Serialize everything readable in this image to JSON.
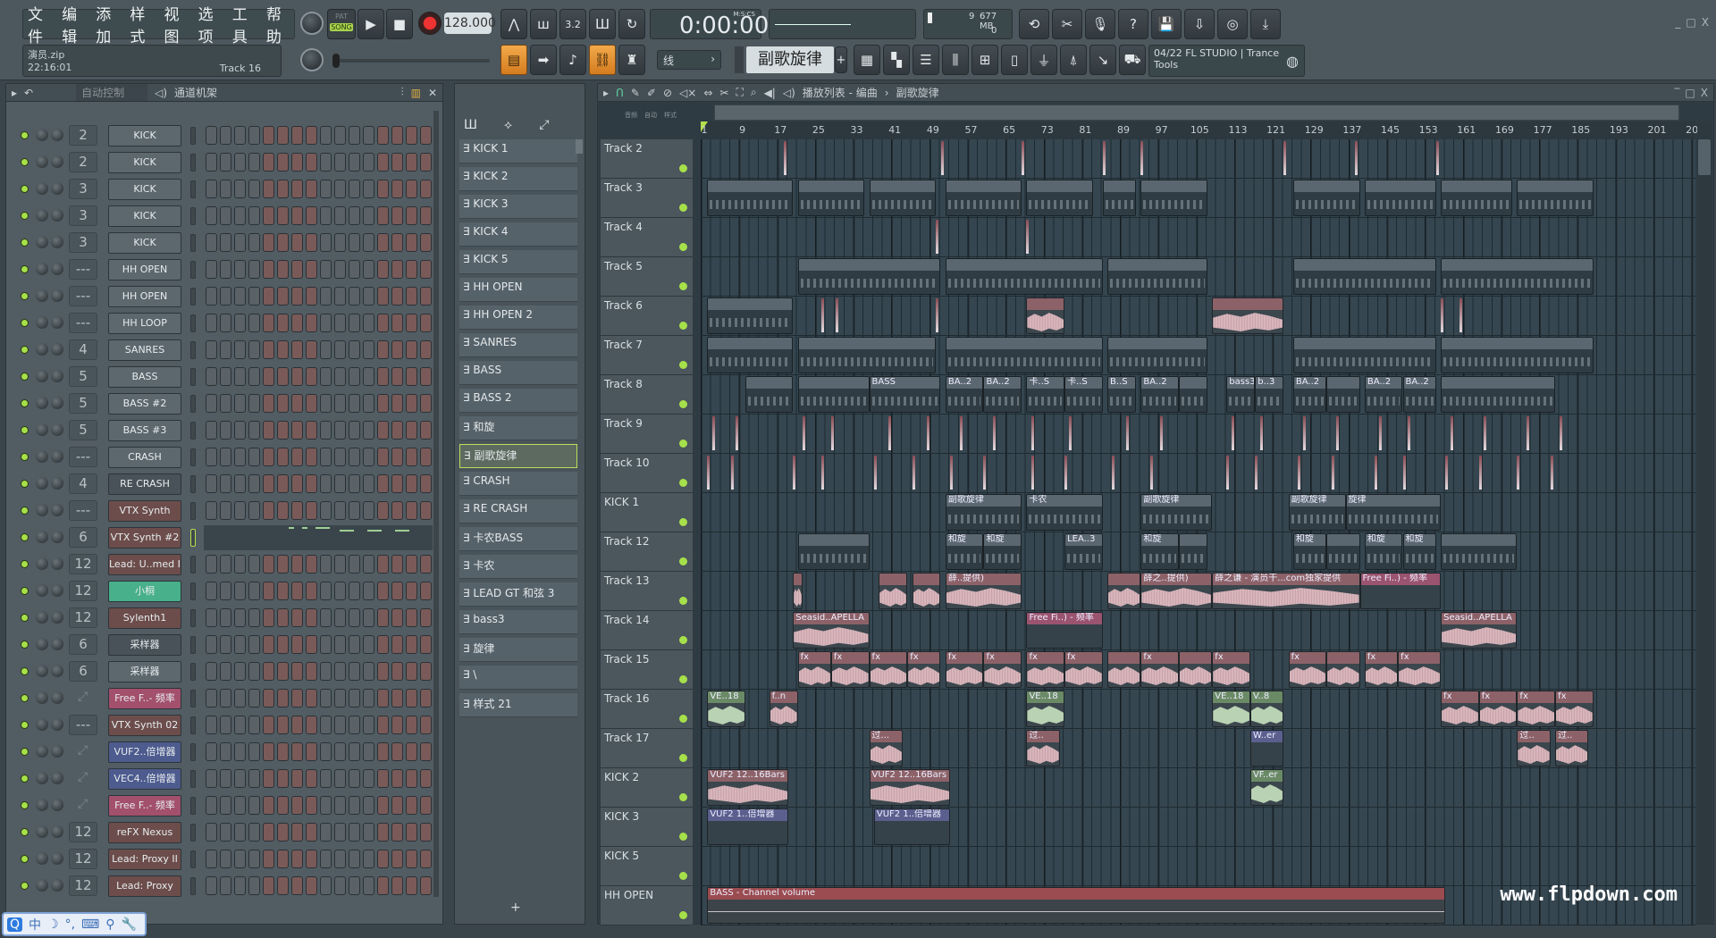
{
  "menu": [
    "文件",
    "编辑",
    "添加",
    "样式",
    "视图",
    "选项",
    "工具",
    "帮助"
  ],
  "transport": {
    "pat": "PAT",
    "song": "SONG",
    "tempo": "128.000",
    "time": "0:00:00",
    "time_unit": "M:S:CS",
    "cpu": "9",
    "memory": "677 MB",
    "poly": "0"
  },
  "hint": {
    "file": "演员.zip",
    "clock": "22:16:01",
    "track": "Track 16"
  },
  "snap": "线",
  "current_pattern": "副歌旋律",
  "add_pattern": "+",
  "news": {
    "line1": "04/22  FL STUDIO | Trance",
    "line2": "Tools"
  },
  "channel_rack": {
    "title": "通道机架",
    "automation_dropdown": "自动控制",
    "channels": [
      {
        "num": "2",
        "name": "KICK",
        "color": "grey"
      },
      {
        "num": "2",
        "name": "KICK",
        "color": "grey"
      },
      {
        "num": "3",
        "name": "KICK",
        "color": "grey"
      },
      {
        "num": "3",
        "name": "KICK",
        "color": "grey"
      },
      {
        "num": "3",
        "name": "KICK",
        "color": "grey"
      },
      {
        "num": "---",
        "name": "HH OPEN",
        "color": "grey"
      },
      {
        "num": "---",
        "name": "HH OPEN",
        "color": "grey"
      },
      {
        "num": "---",
        "name": "HH LOOP",
        "color": "grey"
      },
      {
        "num": "4",
        "name": "SANRES",
        "color": "grey"
      },
      {
        "num": "5",
        "name": "BASS",
        "color": "grey"
      },
      {
        "num": "5",
        "name": "BASS #2",
        "color": "grey"
      },
      {
        "num": "5",
        "name": "BASS #3",
        "color": "grey"
      },
      {
        "num": "---",
        "name": "CRASH",
        "color": "grey"
      },
      {
        "num": "4",
        "name": "RE CRASH",
        "color": "dark"
      },
      {
        "num": "---",
        "name": "VTX Synth",
        "color": "red"
      },
      {
        "num": "6",
        "name": "VTX Synth #2",
        "color": "red",
        "pianoroll": true
      },
      {
        "num": "12",
        "name": "Lead: U..med II",
        "color": "red"
      },
      {
        "num": "12",
        "name": "小桐",
        "color": "green"
      },
      {
        "num": "12",
        "name": "Sylenth1",
        "color": "red"
      },
      {
        "num": "6",
        "name": "采样器",
        "color": "dark"
      },
      {
        "num": "6",
        "name": "采样器",
        "color": "grey"
      },
      {
        "num": "",
        "name": "Free F..- 频率",
        "color": "pink",
        "automation": true
      },
      {
        "num": "---",
        "name": "VTX Synth 02",
        "color": "red"
      },
      {
        "num": "",
        "name": "VUF2..倍增器",
        "color": "blue",
        "automation": true
      },
      {
        "num": "",
        "name": "VEC4..倍增器",
        "color": "blue",
        "automation": true
      },
      {
        "num": "",
        "name": "Free F..- 频率",
        "color": "pink",
        "automation": true
      },
      {
        "num": "12",
        "name": "reFX Nexus",
        "color": "red"
      },
      {
        "num": "12",
        "name": "Lead: Proxy II",
        "color": "red"
      },
      {
        "num": "12",
        "name": "Lead: Proxy",
        "color": "red"
      }
    ],
    "active_steps": [
      4,
      5,
      6,
      7,
      12,
      13,
      14,
      15
    ]
  },
  "patterns": [
    "KICK 1",
    "KICK 2",
    "KICK 3",
    "KICK 4",
    "KICK 5",
    "HH OPEN",
    "HH OPEN 2",
    "SANRES",
    "BASS",
    "BASS 2",
    "和旋",
    "副歌旋律",
    "CRASH",
    "RE CRASH",
    "卡农BASS",
    "卡农",
    "LEAD GT 和弦 3",
    "bass3",
    "旋律",
    "\\",
    "样式 21"
  ],
  "selected_pattern": "副歌旋律",
  "playlist": {
    "title": "播放列表 - 编曲",
    "breadcrumb": "副歌旋律",
    "view_tabs": [
      "音频",
      "自动",
      "样式"
    ],
    "ruler": [
      1,
      9,
      17,
      25,
      33,
      41,
      49,
      57,
      65,
      73,
      81,
      89,
      97,
      105,
      113,
      121,
      129,
      137,
      145,
      153,
      161,
      169,
      177,
      185,
      193,
      201,
      209
    ],
    "tracks": [
      "Track 2",
      "Track 3",
      "Track 4",
      "Track 5",
      "Track 6",
      "Track 7",
      "Track 8",
      "Track 9",
      "Track 10",
      "KICK 1",
      "Track 12",
      "Track 13",
      "Track 14",
      "Track 15",
      "Track 16",
      "Track 17",
      "KICK 2",
      "KICK 3",
      "KICK 5",
      "HH OPEN"
    ],
    "clips": [
      {
        "t": 1,
        "s": 2,
        "e": 20,
        "label": "",
        "kind": "pattern"
      },
      {
        "t": 1,
        "s": 21,
        "e": 35,
        "label": "",
        "kind": "pattern"
      },
      {
        "t": 1,
        "s": 36,
        "e": 50,
        "label": "",
        "kind": "pattern"
      },
      {
        "t": 1,
        "s": 52,
        "e": 68,
        "label": "",
        "kind": "pattern"
      },
      {
        "t": 1,
        "s": 69,
        "e": 83,
        "label": "",
        "kind": "pattern"
      },
      {
        "t": 1,
        "s": 85,
        "e": 92,
        "label": "",
        "kind": "pattern"
      },
      {
        "t": 1,
        "s": 93,
        "e": 107,
        "label": "",
        "kind": "pattern"
      },
      {
        "t": 1,
        "s": 125,
        "e": 139,
        "label": "",
        "kind": "pattern"
      },
      {
        "t": 1,
        "s": 140,
        "e": 155,
        "label": "",
        "kind": "pattern"
      },
      {
        "t": 1,
        "s": 156,
        "e": 171,
        "label": "",
        "kind": "pattern"
      },
      {
        "t": 1,
        "s": 172,
        "e": 188,
        "label": "",
        "kind": "pattern"
      },
      {
        "t": 3,
        "s": 21,
        "e": 51,
        "label": "",
        "kind": "pattern"
      },
      {
        "t": 3,
        "s": 52,
        "e": 85,
        "label": "",
        "kind": "pattern"
      },
      {
        "t": 3,
        "s": 86,
        "e": 107,
        "label": "",
        "kind": "pattern"
      },
      {
        "t": 3,
        "s": 125,
        "e": 155,
        "label": "",
        "kind": "pattern"
      },
      {
        "t": 3,
        "s": 156,
        "e": 188,
        "label": "",
        "kind": "pattern"
      },
      {
        "t": 4,
        "s": 2,
        "e": 20,
        "label": "",
        "kind": "pattern"
      },
      {
        "t": 4,
        "s": 69,
        "e": 77,
        "label": "",
        "kind": "audio"
      },
      {
        "t": 4,
        "s": 108,
        "e": 123,
        "label": "",
        "kind": "audio"
      },
      {
        "t": 5,
        "s": 2,
        "e": 20,
        "label": "",
        "kind": "pattern"
      },
      {
        "t": 5,
        "s": 21,
        "e": 50,
        "label": "",
        "kind": "pattern"
      },
      {
        "t": 5,
        "s": 52,
        "e": 85,
        "label": "",
        "kind": "pattern"
      },
      {
        "t": 5,
        "s": 86,
        "e": 107,
        "label": "",
        "kind": "pattern"
      },
      {
        "t": 5,
        "s": 125,
        "e": 155,
        "label": "",
        "kind": "pattern"
      },
      {
        "t": 5,
        "s": 156,
        "e": 188,
        "label": "",
        "kind": "pattern"
      },
      {
        "t": 6,
        "s": 10,
        "e": 20,
        "label": "",
        "kind": "pattern"
      },
      {
        "t": 6,
        "s": 21,
        "e": 36,
        "label": "",
        "kind": "pattern"
      },
      {
        "t": 6,
        "s": 36,
        "e": 51,
        "label": "BASS",
        "kind": "pattern"
      },
      {
        "t": 6,
        "s": 52,
        "e": 60,
        "label": "BA..2",
        "kind": "pattern"
      },
      {
        "t": 6,
        "s": 60,
        "e": 68,
        "label": "BA..2",
        "kind": "pattern"
      },
      {
        "t": 6,
        "s": 69,
        "e": 77,
        "label": "卡..S",
        "kind": "pattern"
      },
      {
        "t": 6,
        "s": 77,
        "e": 85,
        "label": "卡..S",
        "kind": "pattern"
      },
      {
        "t": 6,
        "s": 86,
        "e": 92,
        "label": "B..S",
        "kind": "pattern"
      },
      {
        "t": 6,
        "s": 93,
        "e": 101,
        "label": "BA..2",
        "kind": "pattern"
      },
      {
        "t": 6,
        "s": 101,
        "e": 107,
        "label": "",
        "kind": "pattern"
      },
      {
        "t": 6,
        "s": 111,
        "e": 117,
        "label": "bass3",
        "kind": "pattern"
      },
      {
        "t": 6,
        "s": 117,
        "e": 123,
        "label": "b..3",
        "kind": "pattern"
      },
      {
        "t": 6,
        "s": 125,
        "e": 132,
        "label": "BA..2",
        "kind": "pattern"
      },
      {
        "t": 6,
        "s": 132,
        "e": 139,
        "label": "",
        "kind": "pattern"
      },
      {
        "t": 6,
        "s": 140,
        "e": 148,
        "label": "BA..2",
        "kind": "pattern"
      },
      {
        "t": 6,
        "s": 148,
        "e": 155,
        "label": "BA..2",
        "kind": "pattern"
      },
      {
        "t": 6,
        "s": 156,
        "e": 180,
        "label": "",
        "kind": "pattern"
      },
      {
        "t": 9,
        "s": 52,
        "e": 68,
        "label": "副歌旋律",
        "kind": "pattern"
      },
      {
        "t": 9,
        "s": 69,
        "e": 85,
        "label": "卡农",
        "kind": "pattern"
      },
      {
        "t": 9,
        "s": 93,
        "e": 108,
        "label": "副歌旋律",
        "kind": "pattern"
      },
      {
        "t": 9,
        "s": 124,
        "e": 136,
        "label": "副歌旋律",
        "kind": "pattern"
      },
      {
        "t": 9,
        "s": 136,
        "e": 156,
        "label": "旋律",
        "kind": "pattern"
      },
      {
        "t": 10,
        "s": 21,
        "e": 36,
        "label": "",
        "kind": "pattern"
      },
      {
        "t": 10,
        "s": 52,
        "e": 60,
        "label": "和旋",
        "kind": "pattern"
      },
      {
        "t": 10,
        "s": 60,
        "e": 68,
        "label": "和旋",
        "kind": "pattern"
      },
      {
        "t": 10,
        "s": 77,
        "e": 85,
        "label": "LEA..3",
        "kind": "pattern"
      },
      {
        "t": 10,
        "s": 93,
        "e": 101,
        "label": "和旋",
        "kind": "pattern"
      },
      {
        "t": 10,
        "s": 101,
        "e": 107,
        "label": "",
        "kind": "pattern"
      },
      {
        "t": 10,
        "s": 125,
        "e": 132,
        "label": "和旋",
        "kind": "pattern"
      },
      {
        "t": 10,
        "s": 132,
        "e": 139,
        "label": "",
        "kind": "pattern"
      },
      {
        "t": 10,
        "s": 140,
        "e": 148,
        "label": "和旋",
        "kind": "pattern"
      },
      {
        "t": 10,
        "s": 148,
        "e": 155,
        "label": "和旋",
        "kind": "pattern"
      },
      {
        "t": 10,
        "s": 156,
        "e": 172,
        "label": "",
        "kind": "pattern"
      },
      {
        "t": 11,
        "s": 20,
        "e": 22,
        "label": "",
        "kind": "audio"
      },
      {
        "t": 11,
        "s": 38,
        "e": 44,
        "label": "",
        "kind": "audio"
      },
      {
        "t": 11,
        "s": 45,
        "e": 51,
        "label": "",
        "kind": "audio"
      },
      {
        "t": 11,
        "s": 52,
        "e": 68,
        "label": "薛..提供)",
        "kind": "audio"
      },
      {
        "t": 11,
        "s": 86,
        "e": 93,
        "label": "",
        "kind": "audio"
      },
      {
        "t": 11,
        "s": 93,
        "e": 108,
        "label": "薛之..提供)",
        "kind": "audio"
      },
      {
        "t": 11,
        "s": 108,
        "e": 139,
        "label": "薛之谦 - 演员干...com独家提供",
        "kind": "audio"
      },
      {
        "t": 11,
        "s": 139,
        "e": 156,
        "label": "Free Fi..) - 频率",
        "kind": "autopink"
      },
      {
        "t": 12,
        "s": 20,
        "e": 36,
        "label": "Seasid..APELLA",
        "kind": "audio"
      },
      {
        "t": 12,
        "s": 69,
        "e": 85,
        "label": "Free Fi..) - 频率",
        "kind": "autopink"
      },
      {
        "t": 12,
        "s": 156,
        "e": 172,
        "label": "Seasid..APELLA",
        "kind": "audio"
      },
      {
        "t": 13,
        "s": 21,
        "e": 28,
        "label": "fx",
        "kind": "audio"
      },
      {
        "t": 13,
        "s": 28,
        "e": 36,
        "label": "fx",
        "kind": "audio"
      },
      {
        "t": 13,
        "s": 36,
        "e": 44,
        "label": "fx",
        "kind": "audio"
      },
      {
        "t": 13,
        "s": 44,
        "e": 51,
        "label": "fx",
        "kind": "audio"
      },
      {
        "t": 13,
        "s": 52,
        "e": 60,
        "label": "fx",
        "kind": "audio"
      },
      {
        "t": 13,
        "s": 60,
        "e": 68,
        "label": "fx",
        "kind": "audio"
      },
      {
        "t": 13,
        "s": 69,
        "e": 77,
        "label": "fx",
        "kind": "audio"
      },
      {
        "t": 13,
        "s": 77,
        "e": 85,
        "label": "fx",
        "kind": "audio"
      },
      {
        "t": 13,
        "s": 86,
        "e": 93,
        "label": "",
        "kind": "audio"
      },
      {
        "t": 13,
        "s": 93,
        "e": 101,
        "label": "fx",
        "kind": "audio"
      },
      {
        "t": 13,
        "s": 101,
        "e": 108,
        "label": "",
        "kind": "audio"
      },
      {
        "t": 13,
        "s": 108,
        "e": 116,
        "label": "fx",
        "kind": "audio"
      },
      {
        "t": 13,
        "s": 124,
        "e": 132,
        "label": "fx",
        "kind": "audio"
      },
      {
        "t": 13,
        "s": 132,
        "e": 139,
        "label": "",
        "kind": "audio"
      },
      {
        "t": 13,
        "s": 140,
        "e": 147,
        "label": "fx",
        "kind": "audio"
      },
      {
        "t": 13,
        "s": 147,
        "e": 156,
        "label": "fx",
        "kind": "audio"
      },
      {
        "t": 14,
        "s": 2,
        "e": 10,
        "label": "VE..18",
        "kind": "green"
      },
      {
        "t": 14,
        "s": 15,
        "e": 21,
        "label": "f..n",
        "kind": "audio"
      },
      {
        "t": 14,
        "s": 69,
        "e": 77,
        "label": "VE..18",
        "kind": "green"
      },
      {
        "t": 14,
        "s": 108,
        "e": 116,
        "label": "VE..18",
        "kind": "green"
      },
      {
        "t": 14,
        "s": 116,
        "e": 123,
        "label": "V..8",
        "kind": "green"
      },
      {
        "t": 14,
        "s": 156,
        "e": 164,
        "label": "fx",
        "kind": "audio"
      },
      {
        "t": 14,
        "s": 164,
        "e": 172,
        "label": "fx",
        "kind": "audio"
      },
      {
        "t": 14,
        "s": 172,
        "e": 180,
        "label": "fx",
        "kind": "audio"
      },
      {
        "t": 14,
        "s": 180,
        "e": 188,
        "label": "fx",
        "kind": "audio"
      },
      {
        "t": 15,
        "s": 36,
        "e": 43,
        "label": "过...",
        "kind": "audio"
      },
      {
        "t": 15,
        "s": 69,
        "e": 76,
        "label": "过..",
        "kind": "audio"
      },
      {
        "t": 15,
        "s": 116,
        "e": 123,
        "label": "W..er",
        "kind": "auto"
      },
      {
        "t": 15,
        "s": 172,
        "e": 179,
        "label": "过..",
        "kind": "audio"
      },
      {
        "t": 15,
        "s": 180,
        "e": 187,
        "label": "过..",
        "kind": "audio"
      },
      {
        "t": 16,
        "s": 2,
        "e": 19,
        "label": "VUF2 12..16Bars",
        "kind": "audio"
      },
      {
        "t": 16,
        "s": 36,
        "e": 53,
        "label": "VUF2 12..16Bars",
        "kind": "audio"
      },
      {
        "t": 16,
        "s": 116,
        "e": 123,
        "label": "VF..er",
        "kind": "green"
      },
      {
        "t": 17,
        "s": 2,
        "e": 19,
        "label": "VUF2 1..倍增器",
        "kind": "auto"
      },
      {
        "t": 17,
        "s": 37,
        "e": 53,
        "label": "VUF2 1..倍增器",
        "kind": "auto"
      },
      {
        "t": 19,
        "s": 2,
        "e": 157,
        "label": "BASS - Channel volume",
        "kind": "autored"
      }
    ],
    "spikes": [
      {
        "t": 0,
        "b": [
          18,
          51,
          68,
          85,
          93,
          123,
          138,
          155
        ]
      },
      {
        "t": 2,
        "b": [
          50,
          69
        ]
      },
      {
        "t": 4,
        "b": [
          26,
          29,
          50,
          156,
          160
        ]
      },
      {
        "t": 7,
        "b": [
          3,
          8,
          22,
          28,
          40,
          48,
          55,
          62,
          70,
          78,
          90,
          97,
          112,
          118,
          127,
          134,
          143,
          149,
          158,
          165,
          174,
          181
        ]
      },
      {
        "t": 8,
        "b": [
          2,
          7,
          20,
          26,
          37,
          45,
          53,
          60,
          70,
          77,
          87,
          95,
          111,
          117,
          126,
          133,
          142,
          148,
          157,
          164,
          172,
          179
        ]
      }
    ]
  },
  "watermark": "www.flpdown.com",
  "colors": {
    "accent": "#f0a040",
    "led": "#a6e04a",
    "step_on": "#7a5a58",
    "step_off": "#5a6268"
  }
}
